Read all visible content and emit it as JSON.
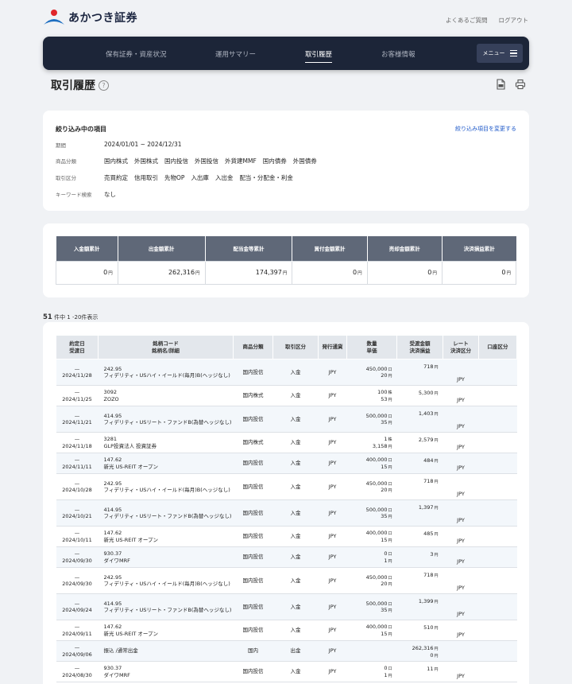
{
  "header": {
    "logo_text": "あかつき証券",
    "links": [
      "よくあるご質問",
      "ログアウト"
    ]
  },
  "nav": {
    "items": [
      {
        "label": "保有証券・資産状況"
      },
      {
        "label": "運用サマリー"
      },
      {
        "label": "取引履歴",
        "active": true
      },
      {
        "label": "お客様情報"
      }
    ],
    "menu_label": "メニュー"
  },
  "page": {
    "title": "取引履歴",
    "help": "?"
  },
  "filter": {
    "heading": "絞り込み中の項目",
    "change_link": "絞り込み項目を変更する",
    "rows": [
      {
        "label": "期間",
        "values": [
          "2024/01/01 ~ 2024/12/31"
        ]
      },
      {
        "label": "商品分類",
        "values": [
          "国内株式",
          "外国株式",
          "国内投信",
          "外国投信",
          "外貨建MMF",
          "国内債券",
          "外国債券"
        ]
      },
      {
        "label": "取引区分",
        "values": [
          "売買約定",
          "信用取引",
          "先物OP",
          "入出庫",
          "入出金",
          "配当・分配金・利金"
        ]
      },
      {
        "label": "キーワード検索",
        "values": [
          "なし"
        ]
      }
    ]
  },
  "summary": {
    "headers": [
      "入金額累計",
      "出金額累計",
      "配当金等累計",
      "買付金額累計",
      "売却金額累計",
      "決済損益累計"
    ],
    "values": [
      "0",
      "262,316",
      "174,397",
      "0",
      "0",
      "0"
    ],
    "unit": "円"
  },
  "count": {
    "total": "51",
    "text": "件中 1 -20件表示"
  },
  "table": {
    "headers": [
      [
        "約定日",
        "受渡日"
      ],
      [
        "銘柄コード",
        "銘柄名/詳細"
      ],
      [
        "商品分類"
      ],
      [
        "取引区分"
      ],
      [
        "発行通貨"
      ],
      [
        "数量",
        "単価"
      ],
      [
        "受渡金額",
        "決済損益"
      ],
      [
        "レート",
        "決済区分"
      ],
      [
        "口座区分"
      ]
    ],
    "rows": [
      {
        "d1": "—",
        "d2": "2024/11/28",
        "code": "242.95",
        "name": "フィデリティ・USハイ・イールド(毎月)B(ヘッジなし)",
        "cat": "国内投信",
        "type": "入金",
        "cur": "JPY",
        "qty": "450,000",
        "qu": "口",
        "price": "20",
        "amt": "718",
        "pl": "",
        "rate": "JPY"
      },
      {
        "d1": "—",
        "d2": "2024/11/25",
        "code": "3092",
        "name": "ZOZO",
        "cat": "国内株式",
        "type": "入金",
        "cur": "JPY",
        "qty": "100",
        "qu": "株",
        "price": "53",
        "amt": "5,300",
        "pl": "",
        "rate": "JPY"
      },
      {
        "d1": "—",
        "d2": "2024/11/21",
        "code": "414.95",
        "name": "フィデリティ・USリート・ファンドB(為替ヘッジなし)",
        "cat": "国内投信",
        "type": "入金",
        "cur": "JPY",
        "qty": "500,000",
        "qu": "口",
        "price": "35",
        "amt": "1,403",
        "pl": "",
        "rate": "JPY"
      },
      {
        "d1": "—",
        "d2": "2024/11/18",
        "code": "3281",
        "name": "GLP投資法人 投資証券",
        "cat": "国内株式",
        "type": "入金",
        "cur": "JPY",
        "qty": "1",
        "qu": "株",
        "price": "3,158",
        "amt": "2,579",
        "pl": "",
        "rate": "JPY"
      },
      {
        "d1": "—",
        "d2": "2024/11/11",
        "code": "147.62",
        "name": "新光 US-REIT オープン",
        "cat": "国内投信",
        "type": "入金",
        "cur": "JPY",
        "qty": "400,000",
        "qu": "口",
        "price": "15",
        "amt": "484",
        "pl": "",
        "rate": "JPY"
      },
      {
        "d1": "—",
        "d2": "2024/10/28",
        "code": "242.95",
        "name": "フィデリティ・USハイ・イールド(毎月)B(ヘッジなし)",
        "cat": "国内投信",
        "type": "入金",
        "cur": "JPY",
        "qty": "450,000",
        "qu": "口",
        "price": "20",
        "amt": "718",
        "pl": "",
        "rate": "JPY"
      },
      {
        "d1": "—",
        "d2": "2024/10/21",
        "code": "414.95",
        "name": "フィデリティ・USリート・ファンドB(為替ヘッジなし)",
        "cat": "国内投信",
        "type": "入金",
        "cur": "JPY",
        "qty": "500,000",
        "qu": "口",
        "price": "35",
        "amt": "1,397",
        "pl": "",
        "rate": "JPY"
      },
      {
        "d1": "—",
        "d2": "2024/10/11",
        "code": "147.62",
        "name": "新光 US-REIT オープン",
        "cat": "国内投信",
        "type": "入金",
        "cur": "JPY",
        "qty": "400,000",
        "qu": "口",
        "price": "15",
        "amt": "485",
        "pl": "",
        "rate": "JPY"
      },
      {
        "d1": "—",
        "d2": "2024/09/30",
        "code": "930.37",
        "name": "ダイワMRF",
        "cat": "国内投信",
        "type": "入金",
        "cur": "JPY",
        "qty": "0",
        "qu": "口",
        "price": "1",
        "amt": "3",
        "pl": "",
        "rate": "JPY"
      },
      {
        "d1": "—",
        "d2": "2024/09/30",
        "code": "242.95",
        "name": "フィデリティ・USハイ・イールド(毎月)B(ヘッジなし)",
        "cat": "国内投信",
        "type": "入金",
        "cur": "JPY",
        "qty": "450,000",
        "qu": "口",
        "price": "20",
        "amt": "718",
        "pl": "",
        "rate": "JPY"
      },
      {
        "d1": "—",
        "d2": "2024/09/24",
        "code": "414.95",
        "name": "フィデリティ・USリート・ファンドB(為替ヘッジなし)",
        "cat": "国内投信",
        "type": "入金",
        "cur": "JPY",
        "qty": "500,000",
        "qu": "口",
        "price": "35",
        "amt": "1,399",
        "pl": "",
        "rate": "JPY"
      },
      {
        "d1": "—",
        "d2": "2024/09/11",
        "code": "147.62",
        "name": "新光 US-REIT オープン",
        "cat": "国内投信",
        "type": "入金",
        "cur": "JPY",
        "qty": "400,000",
        "qu": "口",
        "price": "15",
        "amt": "510",
        "pl": "",
        "rate": "JPY"
      },
      {
        "d1": "—",
        "d2": "2024/09/06",
        "code": "",
        "name": "振込 /通常出金",
        "cat": "国内",
        "type": "出金",
        "cur": "JPY",
        "qty": "",
        "qu": "",
        "price": "",
        "amt": "262,316",
        "pl": "0",
        "rate": ""
      },
      {
        "d1": "—",
        "d2": "2024/08/30",
        "code": "930.37",
        "name": "ダイワMRF",
        "cat": "国内投信",
        "type": "入金",
        "cur": "JPY",
        "qty": "0",
        "qu": "口",
        "price": "1",
        "amt": "11",
        "pl": "",
        "rate": "JPY"
      }
    ],
    "unit": "円"
  }
}
